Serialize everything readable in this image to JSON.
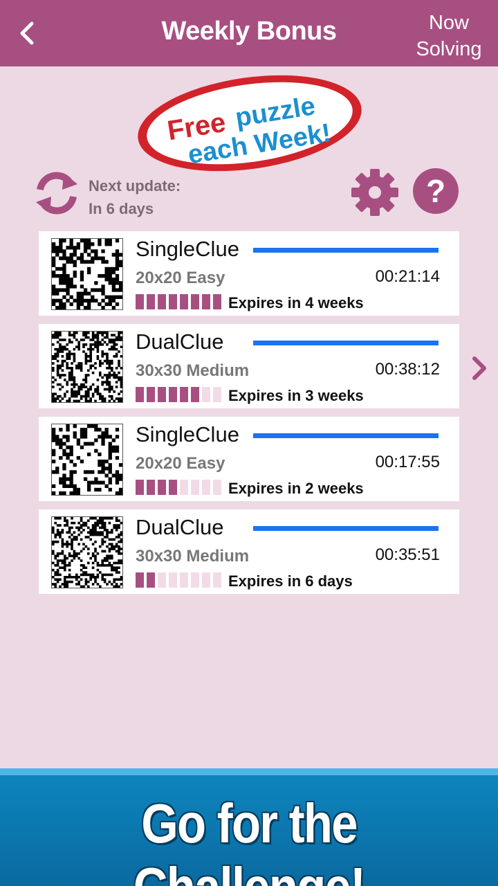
{
  "header": {
    "title": "Weekly Bonus",
    "now_solving_line1": "Now",
    "now_solving_line2": "Solving",
    "background": "#a84f82"
  },
  "promo_badge": {
    "line1_a": "Free",
    "line1_b": "puzzle",
    "line2": "each Week!"
  },
  "update": {
    "label": "Next update:",
    "value": "In 6 days"
  },
  "puzzles": [
    {
      "type": "SingleClue",
      "size": "20x20",
      "difficulty": "Easy",
      "time": "00:21:14",
      "expires": "Expires in 4 weeks",
      "segments_filled": 8,
      "segments_total": 8
    },
    {
      "type": "DualClue",
      "size": "30x30",
      "difficulty": "Medium",
      "time": "00:38:12",
      "expires": "Expires in 3 weeks",
      "segments_filled": 6,
      "segments_total": 8
    },
    {
      "type": "SingleClue",
      "size": "20x20",
      "difficulty": "Easy",
      "time": "00:17:55",
      "expires": "Expires in 2 weeks",
      "segments_filled": 4,
      "segments_total": 8
    },
    {
      "type": "DualClue",
      "size": "30x30",
      "difficulty": "Medium",
      "time": "00:35:51",
      "expires": "Expires in 6 days",
      "segments_filled": 2,
      "segments_total": 8
    }
  ],
  "banner": {
    "text": "Go for the Challenge!"
  },
  "colors": {
    "accent": "#a84f82",
    "progress_line": "#1a73f0",
    "segment_off": "#f2dbe6",
    "background": "#ecd9e4",
    "banner": "#0a6aa0"
  },
  "icons": [
    "back-arrow-icon",
    "refresh-icon",
    "gear-icon",
    "help-icon",
    "chevron-right-icon"
  ]
}
